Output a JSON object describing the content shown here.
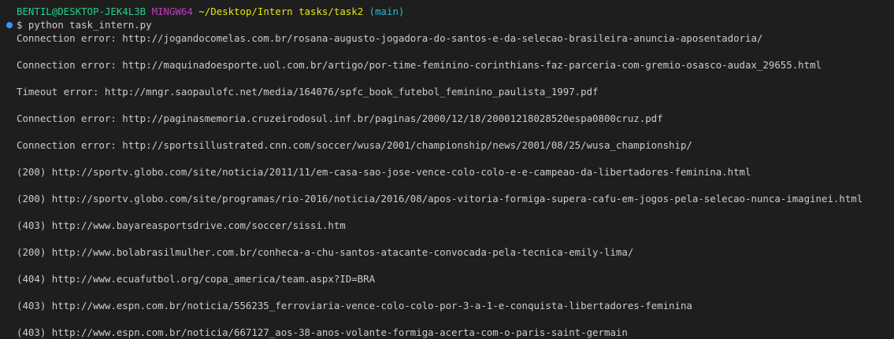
{
  "prompt": {
    "user_host": "BENTIL@DESKTOP-JEK4L3B",
    "env": "MINGW64",
    "path": "~/Desktop/Intern tasks/task2",
    "branch": "(main)"
  },
  "command": "$ python task_intern.py",
  "colors": {
    "background": "#1e1e1e",
    "user_host": "#23d18b",
    "env": "#bc3fbc",
    "path": "#e5e510",
    "branch": "#29b8db",
    "text": "#cccccc",
    "status_dot": "#3794ff"
  },
  "output": [
    "Connection error: http://jogandocomelas.com.br/rosana-augusto-jogadora-do-santos-e-da-selecao-brasileira-anuncia-aposentadoria/",
    "Connection error: http://maquinadoesporte.uol.com.br/artigo/por-time-feminino-corinthians-faz-parceria-com-gremio-osasco-audax_29655.html",
    "Timeout error: http://mngr.saopaulofc.net/media/164076/spfc_book_futebol_feminino_paulista_1997.pdf",
    "Connection error: http://paginasmemoria.cruzeirodosul.inf.br/paginas/2000/12/18/20001218028520espa0800cruz.pdf",
    "Connection error: http://sportsillustrated.cnn.com/soccer/wusa/2001/championship/news/2001/08/25/wusa_championship/",
    "(200) http://sportv.globo.com/site/noticia/2011/11/em-casa-sao-jose-vence-colo-colo-e-e-campeao-da-libertadores-feminina.html",
    "(200) http://sportv.globo.com/site/programas/rio-2016/noticia/2016/08/apos-vitoria-formiga-supera-cafu-em-jogos-pela-selecao-nunca-imaginei.html",
    "(403) http://www.bayareasportsdrive.com/soccer/sissi.htm",
    "(200) http://www.bolabrasilmulher.com.br/conheca-a-chu-santos-atacante-convocada-pela-tecnica-emily-lima/",
    "(404) http://www.ecuafutbol.org/copa_america/team.aspx?ID=BRA",
    "(403) http://www.espn.com.br/noticia/556235_ferroviaria-vence-colo-colo-por-3-a-1-e-conquista-libertadores-feminina",
    "(403) http://www.espn.com.br/noticia/667127_aos-38-anos-volante-formiga-acerta-com-o-paris-saint-germain"
  ]
}
